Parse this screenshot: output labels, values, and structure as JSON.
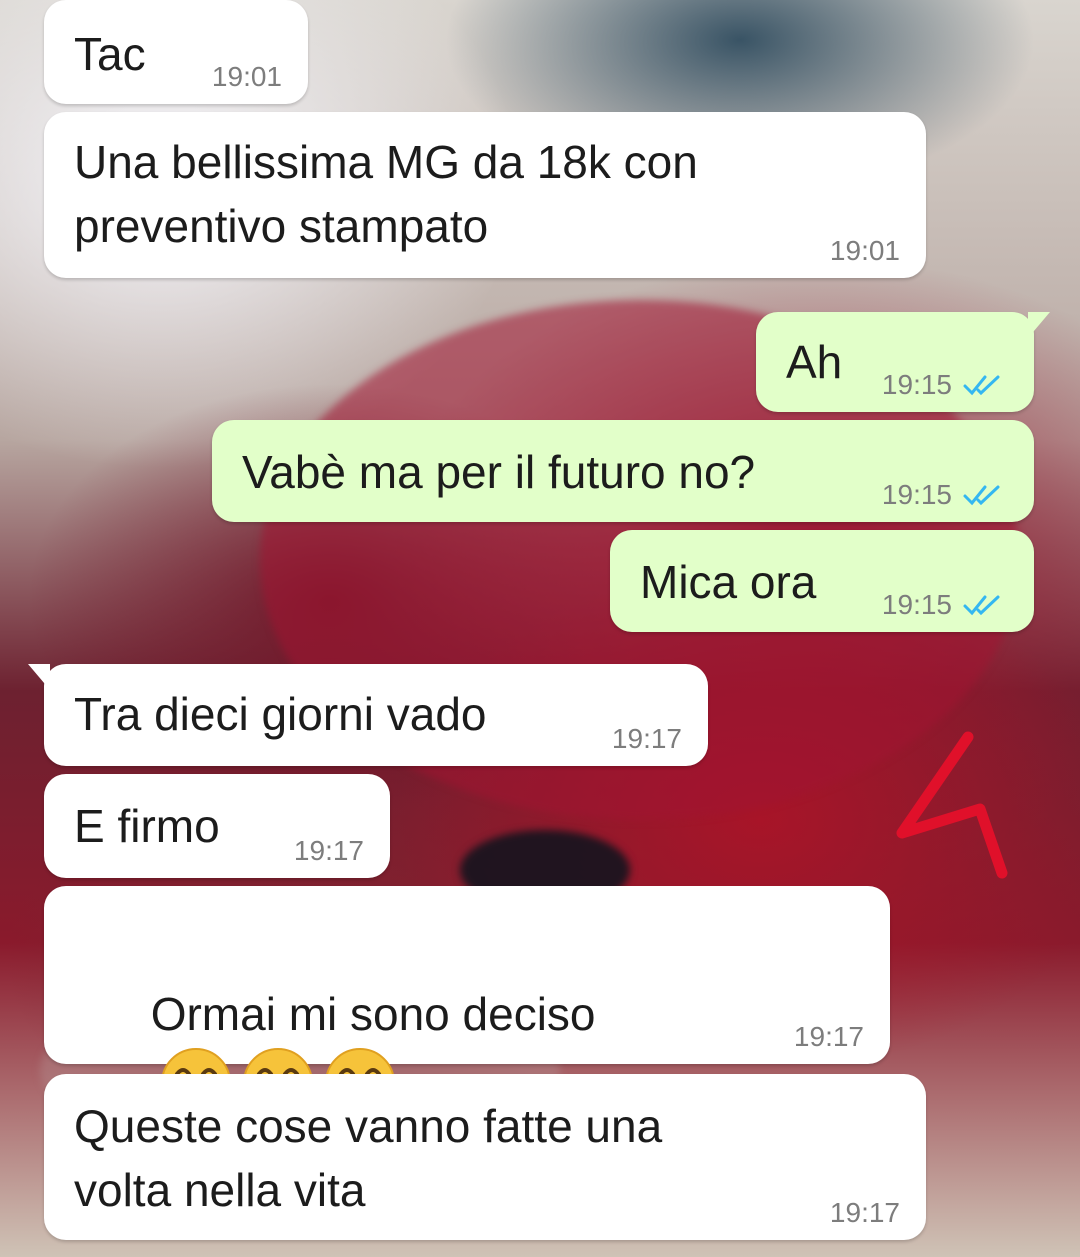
{
  "messages": [
    {
      "direction": "incoming",
      "text": "Tac",
      "time": "19:01"
    },
    {
      "direction": "incoming",
      "text": "Una bellissima MG da 18k con\npreventivo stampato",
      "time": "19:01"
    },
    {
      "direction": "outgoing",
      "text": "Ah",
      "time": "19:15",
      "status": "read"
    },
    {
      "direction": "outgoing",
      "text": "Vabè ma per il futuro no?",
      "time": "19:15",
      "status": "read"
    },
    {
      "direction": "outgoing",
      "text": "Mica ora",
      "time": "19:15",
      "status": "read"
    },
    {
      "direction": "incoming",
      "text": "Tra dieci giorni vado",
      "time": "19:17"
    },
    {
      "direction": "incoming",
      "text": "E firmo",
      "time": "19:17"
    },
    {
      "direction": "incoming",
      "text": "Ormai mi sono deciso",
      "emojis": [
        "grinning-face",
        "grinning-face",
        "grinning-face"
      ],
      "time": "19:17"
    },
    {
      "direction": "incoming",
      "text": "Queste cose vanno fatte una\nvolta nella vita",
      "time": "19:17"
    }
  ],
  "colors": {
    "incoming_bubble": "#ffffff",
    "outgoing_bubble": "#e2ffc9",
    "read_ticks": "#34b7f1",
    "annotation": "#e0102a"
  },
  "icons": {
    "read_receipt": "double-check-icon",
    "annotation": "red-arrow-mark-icon"
  }
}
